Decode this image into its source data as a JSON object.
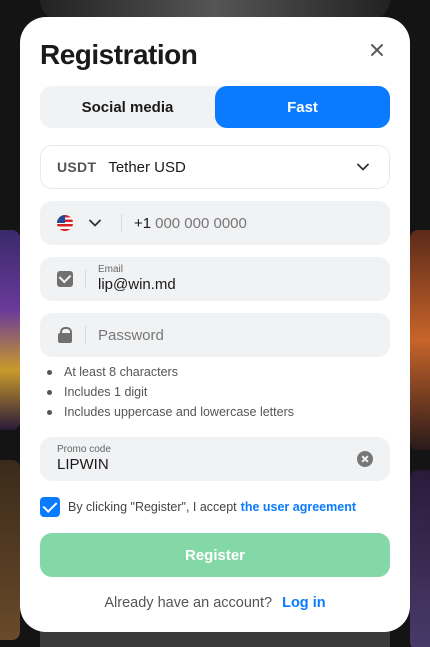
{
  "modal": {
    "title": "Registration",
    "close_icon": "close-icon"
  },
  "tabs": [
    {
      "label": "Social media",
      "active": false
    },
    {
      "label": "Fast",
      "active": true
    }
  ],
  "currency": {
    "code": "USDT",
    "name": "Tether USD",
    "icon": "chevron-down-icon"
  },
  "phone": {
    "flag": "us-flag-icon",
    "code": "+1",
    "placeholder": "000 000 0000"
  },
  "email": {
    "label": "Email",
    "value": "lip@win.md",
    "icon": "mail-icon"
  },
  "password": {
    "placeholder": "Password",
    "icon": "lock-icon"
  },
  "password_rules": [
    "At least 8 characters",
    "Includes 1 digit",
    "Includes uppercase and lowercase letters"
  ],
  "promo": {
    "label": "Promo code",
    "value": "LIPWIN",
    "icon": "clear-icon"
  },
  "agreement": {
    "checked": true,
    "text": "By clicking \"Register\", I accept",
    "link": "the user agreement"
  },
  "register": {
    "label": "Register"
  },
  "login": {
    "question": "Already have an account?",
    "link": "Log in"
  },
  "colors": {
    "accent": "#0a7bff",
    "register_disabled": "#84d8a8",
    "field_bg": "#f1f2f4"
  }
}
